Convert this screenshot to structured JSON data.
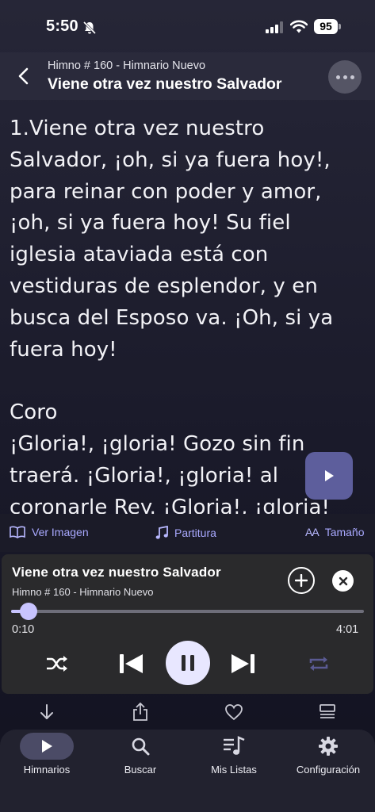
{
  "status_bar": {
    "time": "5:50",
    "battery": "95"
  },
  "header": {
    "subtitle": "Himno # 160 - Himnario Nuevo",
    "title": "Viene otra vez nuestro Salvador"
  },
  "lyrics": {
    "stanza1": "1.Viene otra vez nuestro Salvador, ¡oh, si ya fuera hoy!, para reinar con poder y amor, ¡oh, si ya fuera hoy! Su fiel iglesia ataviada está con vestiduras de esplendor, y en busca del Esposo va. ¡Oh, si ya fuera hoy!",
    "chorus_label": "Coro",
    "chorus": "¡Gloria!, ¡gloria! Gozo sin fin traerá. ¡Gloria!, ¡gloria! al coronarle Rey. ¡Gloria!, ¡gloria!"
  },
  "actions": {
    "ver_imagen": "Ver Imagen",
    "partitura": "Partitura",
    "tamano": "Tamaño",
    "tamano_icon_text": "AA"
  },
  "player": {
    "title": "Viene otra vez nuestro Salvador",
    "subtitle": "Himno # 160 - Himnario Nuevo",
    "current_time": "0:10",
    "total_time": "4:01",
    "progress": 0.05
  },
  "tabs": [
    {
      "label": "Himnarios",
      "icon": "play-icon",
      "active": true
    },
    {
      "label": "Buscar",
      "icon": "search-icon",
      "active": false
    },
    {
      "label": "Mis Listas",
      "icon": "playlist-icon",
      "active": false
    },
    {
      "label": "Configuración",
      "icon": "gear-icon",
      "active": false
    }
  ],
  "colors": {
    "accent": "#c8c4ff",
    "play_button": "#5d5e9c",
    "background": "#1c1c2c"
  }
}
